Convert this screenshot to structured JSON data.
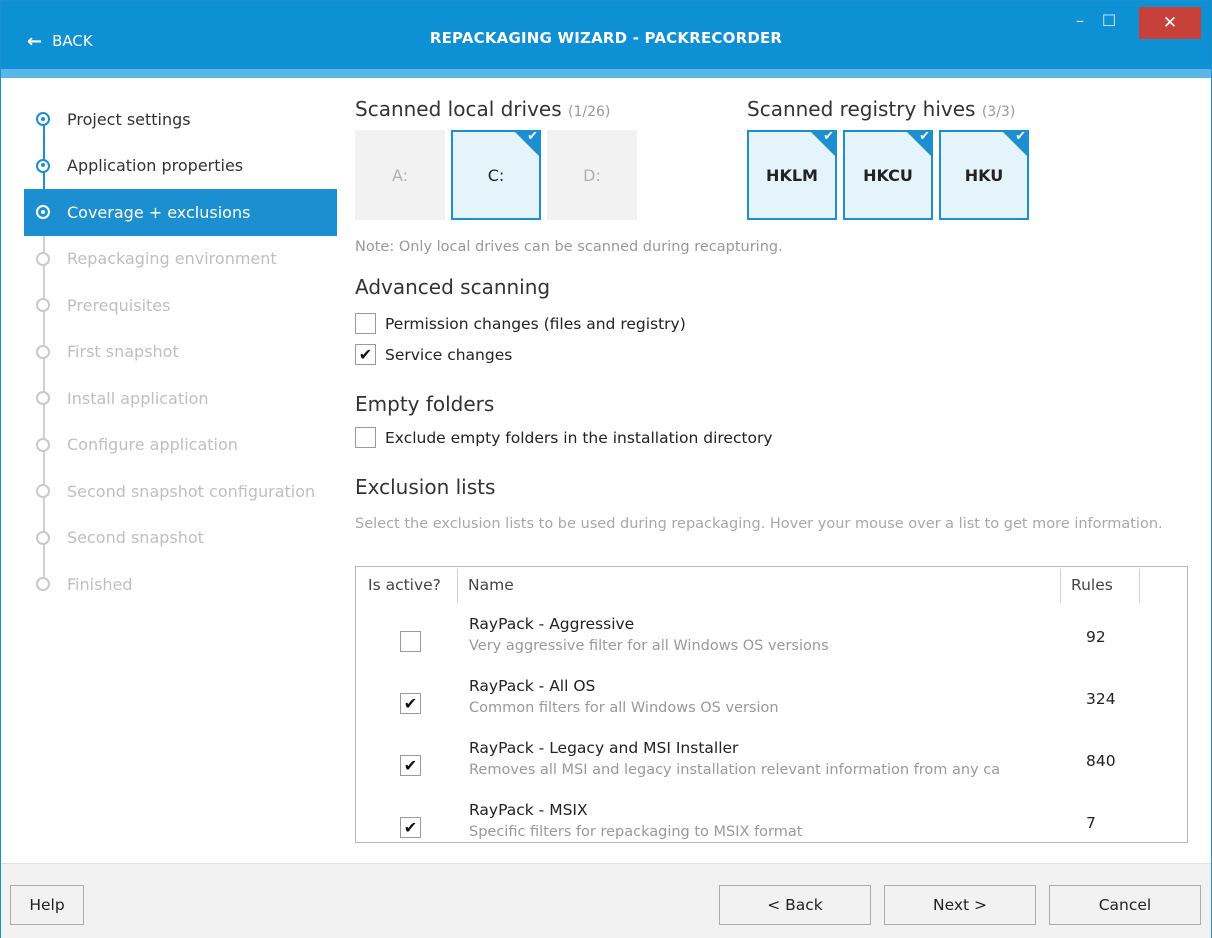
{
  "titlebar": {
    "back_label": "BACK",
    "title": "REPACKAGING WIZARD - PACKRECORDER",
    "minimize_glyph": "–",
    "maximize_glyph": "☐",
    "close_glyph": "✕"
  },
  "sidebar": {
    "steps": [
      {
        "label": "Project settings",
        "state": "done"
      },
      {
        "label": "Application properties",
        "state": "done"
      },
      {
        "label": "Coverage + exclusions",
        "state": "active"
      },
      {
        "label": "Repackaging environment",
        "state": "pending"
      },
      {
        "label": "Prerequisites",
        "state": "pending"
      },
      {
        "label": "First snapshot",
        "state": "pending"
      },
      {
        "label": "Install application",
        "state": "pending"
      },
      {
        "label": "Configure application",
        "state": "pending"
      },
      {
        "label": "Second snapshot configuration",
        "state": "pending"
      },
      {
        "label": "Second snapshot",
        "state": "pending"
      },
      {
        "label": "Finished",
        "state": "pending"
      }
    ]
  },
  "drives": {
    "heading": "Scanned local drives",
    "count": "(1/26)",
    "items": [
      {
        "label": "A:",
        "selected": false
      },
      {
        "label": "C:",
        "selected": true
      },
      {
        "label": "D:",
        "selected": false
      }
    ]
  },
  "hives": {
    "heading": "Scanned registry hives",
    "count": "(3/3)",
    "items": [
      {
        "label": "HKLM",
        "selected": true
      },
      {
        "label": "HKCU",
        "selected": true
      },
      {
        "label": "HKU",
        "selected": true
      }
    ]
  },
  "check_glyph": "✔",
  "note": "Note: Only local drives can be scanned during recapturing.",
  "advanced": {
    "heading": "Advanced scanning",
    "permission_label": "Permission changes (files and registry)",
    "permission_checked": false,
    "service_label": "Service changes",
    "service_checked": true
  },
  "empty_folders": {
    "heading": "Empty folders",
    "exclude_label": "Exclude empty folders in the installation directory",
    "exclude_checked": false
  },
  "exclusions": {
    "heading": "Exclusion lists",
    "description": "Select the exclusion lists to be used during repackaging. Hover your mouse over a list to get more information.",
    "columns": [
      "Is active?",
      "Name",
      "Rules"
    ],
    "rows": [
      {
        "name": "RayPack - Aggressive",
        "desc": "Very aggressive filter for all Windows OS versions",
        "rules": "92",
        "active": false
      },
      {
        "name": "RayPack - All OS",
        "desc": "Common filters for all Windows OS version",
        "rules": "324",
        "active": true
      },
      {
        "name": "RayPack - Legacy and MSI Installer",
        "desc": "Removes all MSI and legacy installation relevant information from any ca",
        "rules": "840",
        "active": true
      },
      {
        "name": "RayPack - MSIX",
        "desc": "Specific filters for repackaging to MSIX format",
        "rules": "7",
        "active": true
      }
    ]
  },
  "footer": {
    "help": "Help",
    "back": "< Back",
    "next": "Next >",
    "cancel": "Cancel"
  },
  "colors": {
    "accent": "#1b8fd0",
    "titlebar": "#0e90d4",
    "close": "#c7403a"
  }
}
